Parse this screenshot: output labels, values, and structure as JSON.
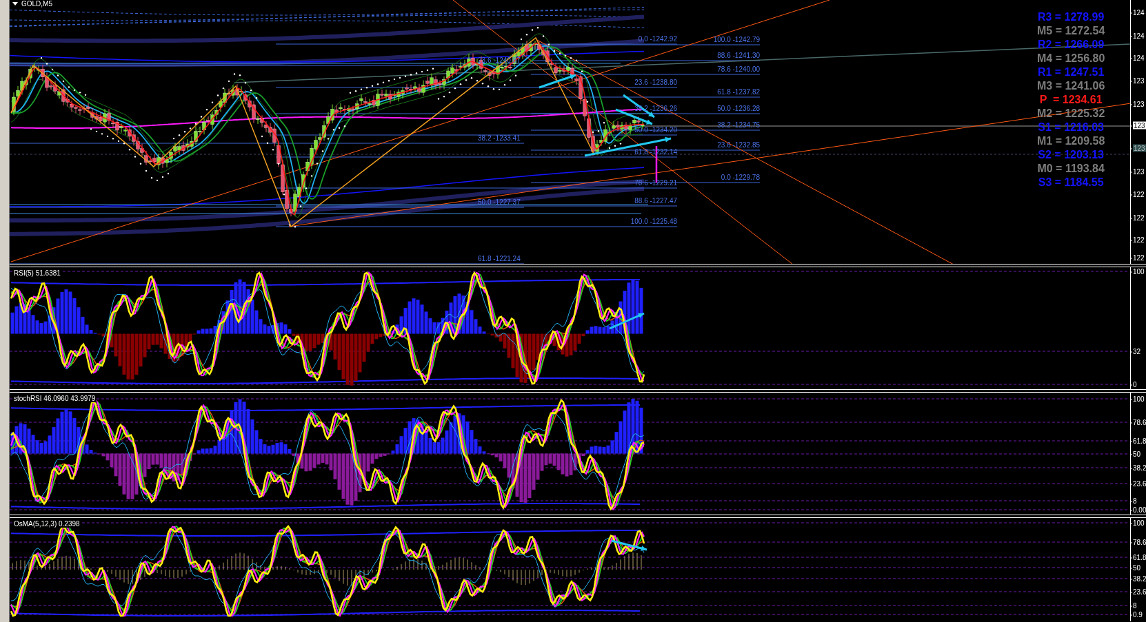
{
  "chart": {
    "symbol": "GOLD,M5",
    "price_axis": [
      {
        "label": "124",
        "kind": "tick"
      },
      {
        "label": "124",
        "kind": "tick"
      },
      {
        "label": "124",
        "kind": "tick"
      },
      {
        "label": "123",
        "kind": "tick"
      },
      {
        "label": "123",
        "kind": "tick"
      },
      {
        "label": "123",
        "kind": "last-price"
      },
      {
        "label": "123",
        "kind": "bid"
      },
      {
        "label": "123",
        "kind": "tick"
      },
      {
        "label": "122",
        "kind": "tick"
      },
      {
        "label": "122",
        "kind": "tick"
      },
      {
        "label": "122",
        "kind": "tick"
      },
      {
        "label": "122",
        "kind": "tick"
      }
    ],
    "fibonacci_labels": [
      "0.0 -1242.92",
      "100.0 -1242.79",
      "88.6 -1241.30",
      "23.6 -1240.87",
      "78.6 -1240.00",
      "23.6 -1238.80",
      "61.8 -1237.82",
      "38.2 -1236.26",
      "50.0 -1236.28",
      "38.2 -1234.75",
      "50.0 -1234.20",
      "38.2 -1233.41",
      "23.6 -1232.85",
      "61.8 -1232.14",
      "0.0 -1229.78",
      "78.6 -1229.21",
      "88.6 -1227.47",
      "50.0 -1227.37",
      "100.0 -1225.48",
      "61.8 -1221.24"
    ],
    "pivot_levels": [
      {
        "label": "R3 = 1278.99",
        "kind": "resistance"
      },
      {
        "label": "M5 = 1272.54",
        "kind": "mid"
      },
      {
        "label": "R2 = 1266.09",
        "kind": "resistance"
      },
      {
        "label": "M4 = 1256.80",
        "kind": "mid"
      },
      {
        "label": "R1 = 1247.51",
        "kind": "resistance"
      },
      {
        "label": "M3 = 1241.06",
        "kind": "mid"
      },
      {
        "label": "P  = 1234.61",
        "kind": "pivot"
      },
      {
        "label": "M2 = 1225.32",
        "kind": "mid"
      },
      {
        "label": "S1 = 1216.03",
        "kind": "support"
      },
      {
        "label": "M1 = 1209.58",
        "kind": "mid"
      },
      {
        "label": "S2 = 1203.13",
        "kind": "support"
      },
      {
        "label": "M0 = 1193.84",
        "kind": "mid"
      },
      {
        "label": "S3 = 1184.55",
        "kind": "support"
      }
    ]
  },
  "indicators": [
    {
      "title": "RSI(5) 51.6381",
      "kind": "rsi",
      "axis": [
        "100",
        "32",
        "0"
      ]
    },
    {
      "title": "stochRSI 46.0960 43.9979",
      "kind": "stoch",
      "axis": [
        "100",
        "78.6",
        "61.8",
        "50",
        "38.2",
        "23.6",
        "8",
        "0.00"
      ]
    },
    {
      "title": "OsMA(5,12,3) 0.2398",
      "kind": "osma",
      "axis": [
        "100",
        "78.6",
        "61.8",
        "50",
        "38.2",
        "23.6",
        "8",
        "0.9"
      ]
    }
  ]
}
